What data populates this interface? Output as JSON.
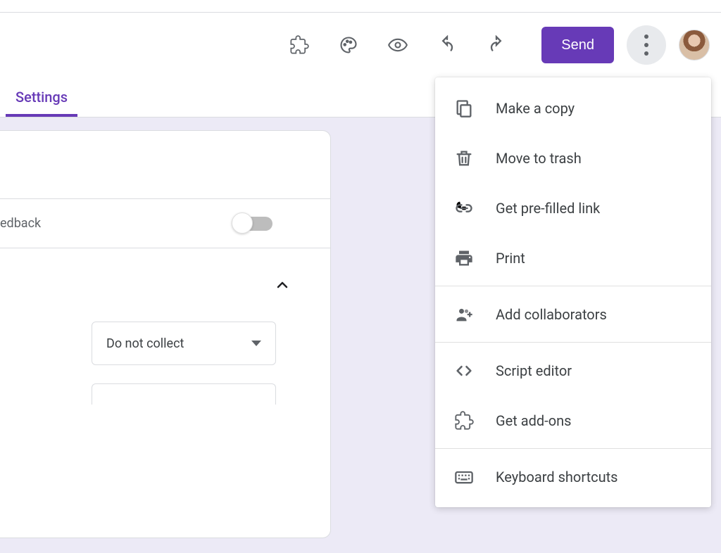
{
  "toolbar": {
    "send_label": "Send"
  },
  "tabs": {
    "settings": "Settings"
  },
  "settings": {
    "feedback_label": "edback",
    "collect_select": "Do not collect"
  },
  "menu": {
    "make_copy": "Make a copy",
    "move_trash": "Move to trash",
    "prefilled": "Get pre-filled link",
    "print": "Print",
    "collaborators": "Add collaborators",
    "script": "Script editor",
    "addons": "Get add-ons",
    "keyboard": "Keyboard shortcuts"
  }
}
